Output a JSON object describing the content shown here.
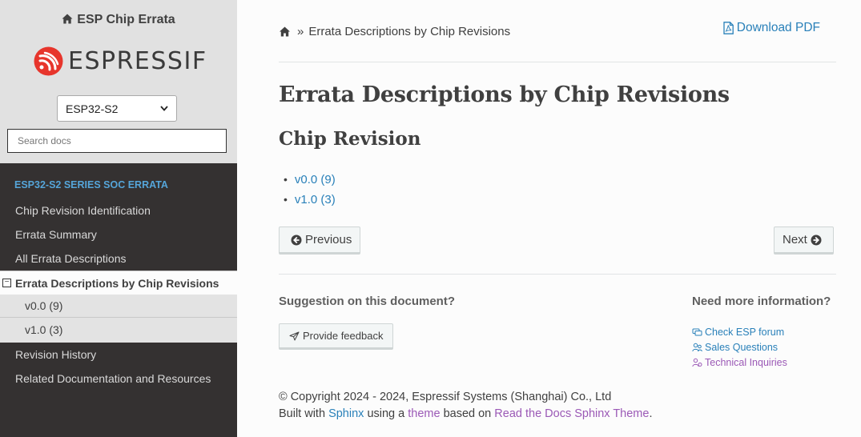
{
  "sidebar": {
    "project_title": "ESP Chip Errata",
    "logo_text": "ESPRESSIF",
    "version_select": "ESP32-S2",
    "search_placeholder": "Search docs",
    "nav_caption": "ESP32-S2 Series SoC Errata",
    "items": [
      {
        "label": "Chip Revision Identification"
      },
      {
        "label": "Errata Summary"
      },
      {
        "label": "All Errata Descriptions"
      },
      {
        "label": "Errata Descriptions by Chip Revisions"
      },
      {
        "label": "Revision History"
      },
      {
        "label": "Related Documentation and Resources"
      }
    ],
    "subitems": [
      {
        "label": "v0.0 (9)"
      },
      {
        "label": "v1.0 (3)"
      }
    ]
  },
  "breadcrumb": {
    "separator": "»",
    "current": "Errata Descriptions by Chip Revisions"
  },
  "download_label": "Download PDF",
  "page_title": "Errata Descriptions by Chip Revisions",
  "section_title": "Chip Revision",
  "revisions": [
    "v0.0 (9)",
    "v1.0 (3)"
  ],
  "nav_buttons": {
    "previous": "Previous",
    "next": "Next"
  },
  "feedback": {
    "heading": "Suggestion on this document?",
    "button": "Provide feedback"
  },
  "more_info": {
    "heading": "Need more information?",
    "links": [
      "Check ESP forum",
      "Sales Questions",
      "Technical Inquiries"
    ]
  },
  "footer": {
    "copyright": "© Copyright 2024 - 2024, Espressif Systems (Shanghai) Co., Ltd",
    "built_with": "Built with",
    "sphinx": "Sphinx",
    "using_a": "using a",
    "theme": "theme",
    "based_on": "based on",
    "rtd_theme": "Read the Docs Sphinx Theme",
    "period": "."
  },
  "colors": {
    "link": "#2980b9",
    "visited": "#9b59b6",
    "caption": "#55a5d9",
    "sidebar_bg": "#343131",
    "brand_red": "#e7352c"
  }
}
